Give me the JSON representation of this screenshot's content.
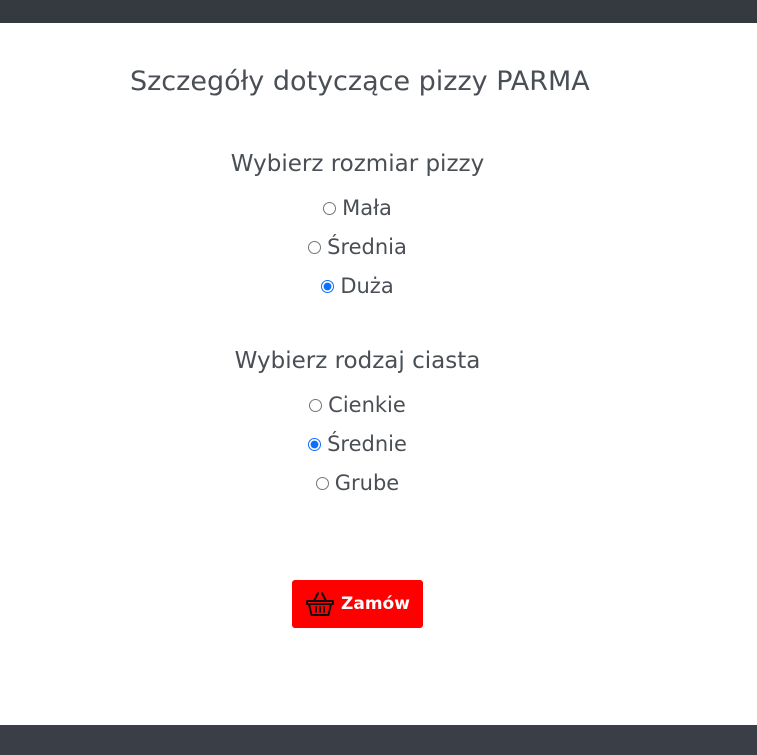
{
  "page": {
    "title": "Szczegóły dotyczące pizzy PARMA"
  },
  "size_group": {
    "title": "Wybierz rozmiar pizzy",
    "options": [
      {
        "label": "Mała",
        "checked": false
      },
      {
        "label": "Średnia",
        "checked": false
      },
      {
        "label": "Duża",
        "checked": true
      }
    ]
  },
  "dough_group": {
    "title": "Wybierz rodzaj ciasta",
    "options": [
      {
        "label": "Cienkie",
        "checked": false
      },
      {
        "label": "Średnie",
        "checked": true
      },
      {
        "label": "Grube",
        "checked": false
      }
    ]
  },
  "order_button": {
    "label": "Zamów",
    "icon": "basket-icon",
    "color": "#ff0000"
  },
  "colors": {
    "topbar": "#343a40",
    "footer": "#3a3f47",
    "text": "#4a4f55",
    "accent": "#0d6efd"
  }
}
